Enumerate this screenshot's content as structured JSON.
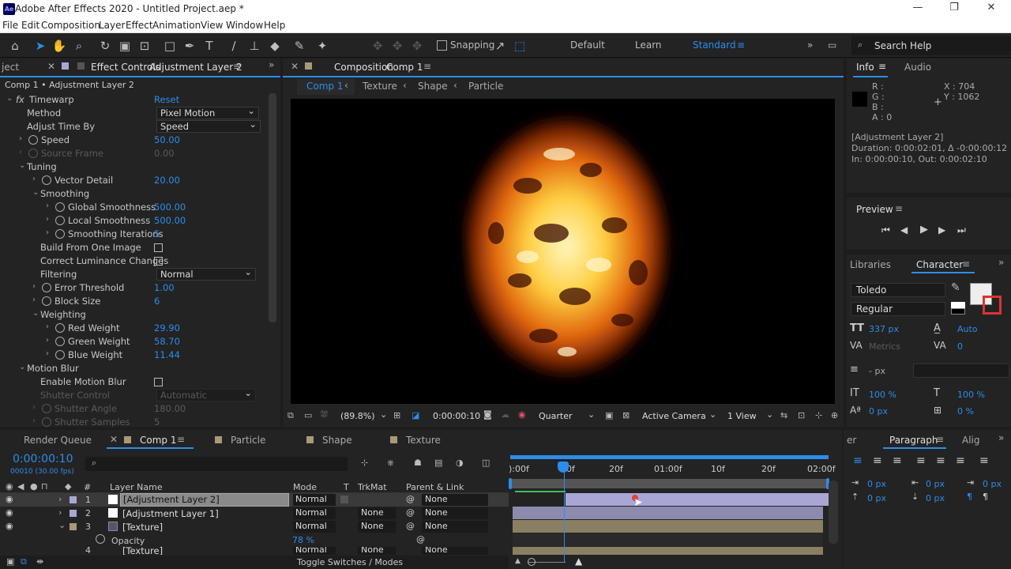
{
  "window": {
    "title": "Adobe After Effects 2020 - Untitled Project.aep *",
    "logo": "Ae",
    "minimize": "—",
    "restore": "❐",
    "close": "✕"
  },
  "menu": [
    "File",
    "Edit",
    "Composition",
    "Layer",
    "Effect",
    "Animation",
    "View",
    "Window",
    "Help"
  ],
  "toolbar": {
    "snapping": "Snapping",
    "workspaces": [
      "Default",
      "Learn",
      "Standard"
    ],
    "search": "Search Help"
  },
  "effect_controls": {
    "left_tab": "ject",
    "tab_label": "Effect Controls",
    "layer": "Adjustment Layer 2",
    "breadcrumb": "Comp 1 • Adjustment Layer 2",
    "effect": "Timewarp",
    "reset": "Reset",
    "rows": [
      {
        "label": "Method",
        "dropdown": "Pixel Motion"
      },
      {
        "label": "Adjust Time By",
        "dropdown": "Speed"
      },
      {
        "label": "Speed",
        "value": "50.00"
      },
      {
        "label": "Source Frame",
        "value": "0.00"
      },
      {
        "label": "Tuning"
      },
      {
        "label": "Vector Detail",
        "value": "20.00"
      },
      {
        "label": "Smoothing"
      },
      {
        "label": "Global Smoothness",
        "value": "500.00"
      },
      {
        "label": "Local Smoothness",
        "value": "500.00"
      },
      {
        "label": "Smoothing Iterations",
        "value": "5"
      },
      {
        "label": "Build From One Image"
      },
      {
        "label": "Correct Luminance Changes"
      },
      {
        "label": "Filtering",
        "dropdown": "Normal"
      },
      {
        "label": "Error Threshold",
        "value": "1.00"
      },
      {
        "label": "Block Size",
        "value": "6"
      },
      {
        "label": "Weighting"
      },
      {
        "label": "Red Weight",
        "value": "29.90"
      },
      {
        "label": "Green Weight",
        "value": "58.70"
      },
      {
        "label": "Blue Weight",
        "value": "11.44"
      },
      {
        "label": "Motion Blur"
      },
      {
        "label": "Enable Motion Blur"
      },
      {
        "label": "Shutter Control",
        "dropdown": "Automatic"
      },
      {
        "label": "Shutter Angle",
        "value": "180.00"
      },
      {
        "label": "Shutter Samples",
        "value": "5"
      }
    ]
  },
  "composition": {
    "tab_label": "Composition",
    "comp": "Comp 1",
    "crumbs": [
      "Comp 1",
      "Texture",
      "Shape",
      "Particle"
    ],
    "footer": {
      "zoom": "(89.8%)",
      "time": "0:00:00:10",
      "resolution": "Quarter",
      "camera": "Active Camera",
      "views": "1 View"
    }
  },
  "info": {
    "tab": "Info",
    "audio_tab": "Audio",
    "r": "R :",
    "g": "G :",
    "b": "B :",
    "a": "A :  0",
    "x": "X : 704",
    "y": "Y : 1062",
    "layer": "[Adjustment Layer 2]",
    "duration": "Duration: 0:00:02:01, Δ -0:00:00:12",
    "inout": "In: 0:00:00:10, Out: 0:00:02:10"
  },
  "preview": {
    "tab": "Preview"
  },
  "character": {
    "libraries": "Libraries",
    "tab": "Character",
    "font": "Toledo",
    "style": "Regular",
    "size": "337 px",
    "leading": "Auto",
    "kerning": "Metrics",
    "tracking": "0",
    "stroke": "- px",
    "vscale": "100 %",
    "hscale": "100 %",
    "baseline": "0 px",
    "tsume": "0 %"
  },
  "paragraph": {
    "left_tab": "er",
    "tab": "Paragraph",
    "align_tab": "Alig",
    "indent_left": "0 px",
    "indent_first": "0 px",
    "indent_right": "0 px",
    "space_before": "0 px",
    "space_after": "0 px"
  },
  "timeline": {
    "tabs": [
      "Render Queue",
      "Comp 1",
      "Particle",
      "Shape",
      "Texture"
    ],
    "time": "0:00:00:10",
    "fps": "00010 (30.00 fps)",
    "headers": {
      "num": "#",
      "name": "Layer Name",
      "mode": "Mode",
      "t": "T",
      "trkmat": "TrkMat",
      "parent": "Parent & Link"
    },
    "ruler": [
      "):00f",
      "10f",
      "20f",
      "01:00f",
      "10f",
      "20f",
      "02:00f"
    ],
    "layers": [
      {
        "num": "1",
        "name": "[Adjustment Layer 2]",
        "mode": "Normal",
        "trkmat": "",
        "parent": "None"
      },
      {
        "num": "2",
        "name": "[Adjustment Layer 1]",
        "mode": "Normal",
        "trkmat": "None",
        "parent": "None"
      },
      {
        "num": "3",
        "name": "[Texture]",
        "mode": "Normal",
        "trkmat": "None",
        "parent": "None"
      },
      {
        "num": "4",
        "name": "[Texture]",
        "mode": "Normal",
        "trkmat": "None",
        "parent": "None"
      }
    ],
    "opacity_label": "Opacity",
    "opacity_value": "78 %",
    "toggle": "Toggle Switches / Modes"
  },
  "colors": {
    "accent": "#2d8ceb",
    "panel": "#232323",
    "layer_purple": "#a9a6d6",
    "layer_tan": "#a89a79"
  }
}
